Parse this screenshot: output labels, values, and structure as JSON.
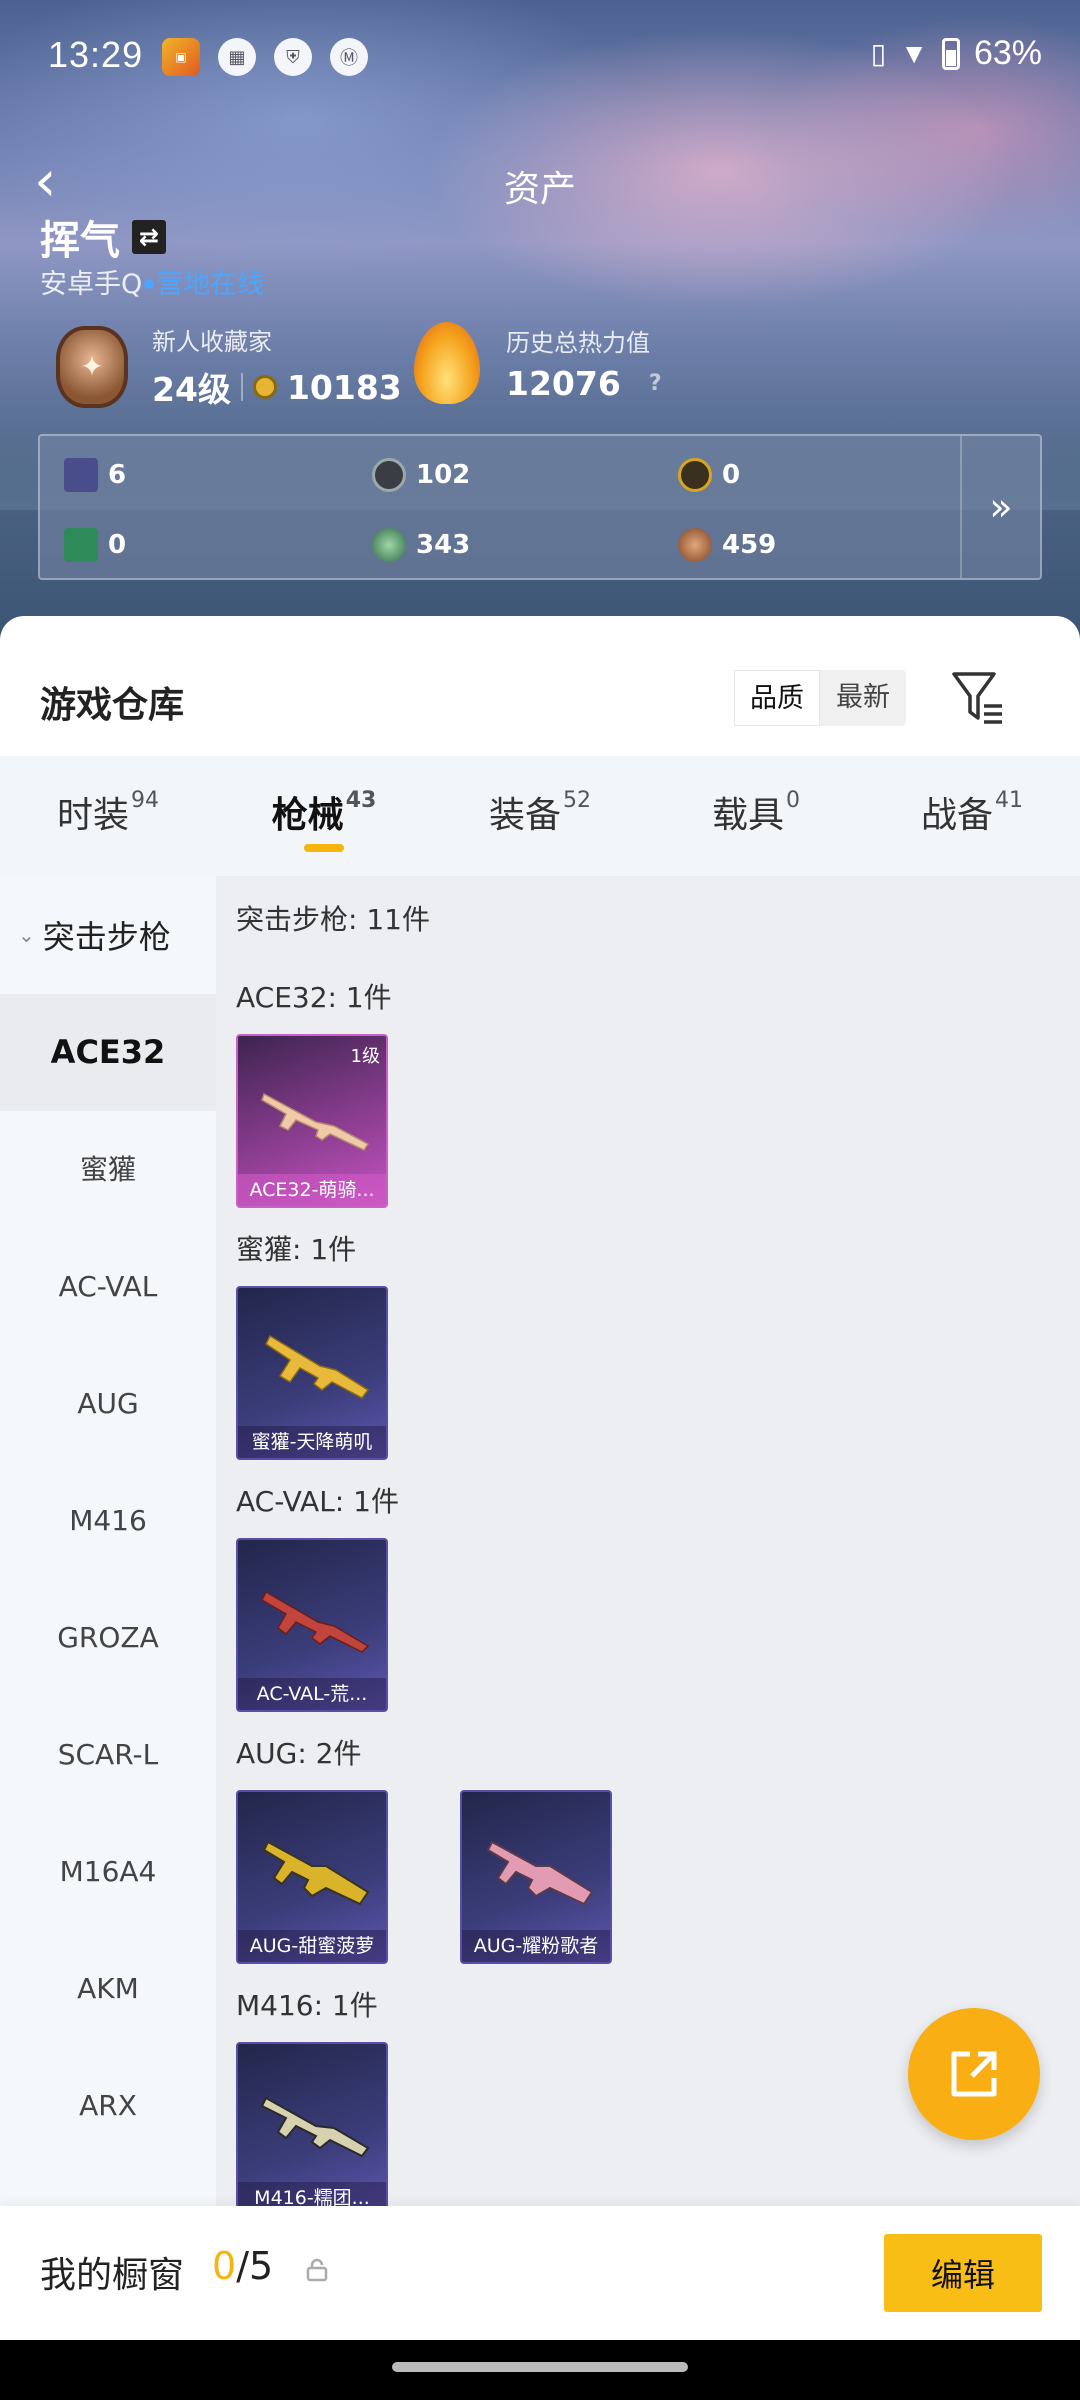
{
  "status_bar": {
    "time": "13:29",
    "battery": "63%",
    "icons": [
      "game-app-icon",
      "calendar-icon",
      "shield-icon",
      "motorola-icon",
      "vibrate-icon",
      "wifi-icon",
      "battery-icon"
    ]
  },
  "header": {
    "title": "资产",
    "username": "挥气",
    "platform": "安卓手Q",
    "online_status": "营地在线",
    "collector": {
      "label": "新人收藏家",
      "level": "24级",
      "points": "10183"
    },
    "heat": {
      "label": "历史总热力值",
      "value": "12076",
      "help": "?"
    }
  },
  "stats": {
    "row1": [
      "6",
      "102",
      "0"
    ],
    "row2": [
      "0",
      "343",
      "459"
    ],
    "more": "»"
  },
  "warehouse": {
    "title": "游戏仓库",
    "sort_options": [
      "品质",
      "最新"
    ],
    "sort_selected": "品质"
  },
  "tabs": [
    {
      "label": "时装",
      "count": "94"
    },
    {
      "label": "枪械",
      "count": "43"
    },
    {
      "label": "装备",
      "count": "52"
    },
    {
      "label": "载具",
      "count": "0"
    },
    {
      "label": "战备",
      "count": "41"
    }
  ],
  "active_tab": "枪械",
  "categories": {
    "header": "突击步枪",
    "items": [
      "ACE32",
      "蜜獾",
      "AC-VAL",
      "AUG",
      "M416",
      "GROZA",
      "SCAR-L",
      "M16A4",
      "AKM",
      "ARX"
    ],
    "selected": "ACE32"
  },
  "items": {
    "section_title": "突击步枪: 11件",
    "groups": [
      {
        "title": "ACE32: 1件",
        "cards": [
          {
            "name": "ACE32-萌骑...",
            "level": "1级",
            "rarity": "pink"
          }
        ]
      },
      {
        "title": "蜜獾: 1件",
        "cards": [
          {
            "name": "蜜獾-天降萌叽",
            "rarity": "purple"
          }
        ]
      },
      {
        "title": "AC-VAL: 1件",
        "cards": [
          {
            "name": "AC-VAL-荒...",
            "rarity": "purple"
          }
        ]
      },
      {
        "title": "AUG: 2件",
        "cards": [
          {
            "name": "AUG-甜蜜菠萝",
            "rarity": "purple"
          },
          {
            "name": "AUG-耀粉歌者",
            "rarity": "purple"
          }
        ]
      },
      {
        "title": "M416: 1件",
        "cards": [
          {
            "name": "M416-糯团...",
            "rarity": "purple"
          }
        ]
      }
    ]
  },
  "showcase": {
    "label": "我的橱窗",
    "current": "0",
    "total": "/5",
    "edit_label": "编辑"
  },
  "colors": {
    "accent": "#f6b40e",
    "online": "#4aa6ff",
    "rarity_pink": "#c554c2",
    "rarity_purple": "#5e57b0"
  }
}
